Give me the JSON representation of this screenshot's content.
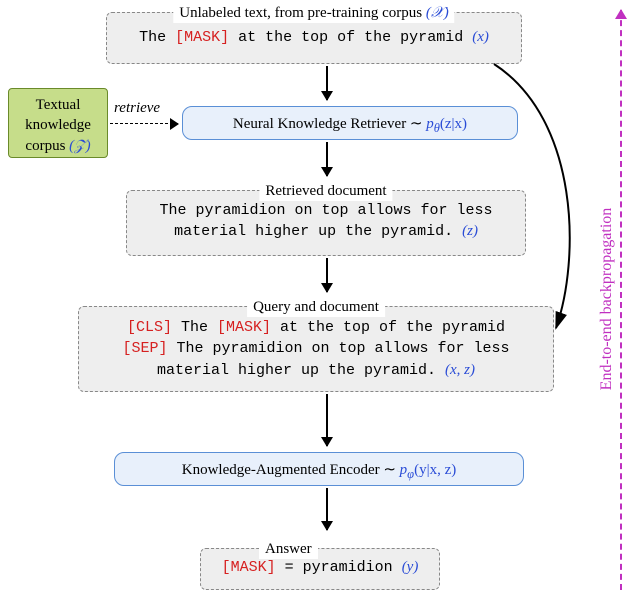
{
  "box1": {
    "title_a": "Unlabeled text, from pre-training corpus ",
    "title_b": "(𝒳)",
    "line1_a": "The ",
    "line1_mask": "[MASK]",
    "line1_b": " at the top of the pyramid ",
    "line1_var": "(x)"
  },
  "knowledge": {
    "l1": "Textual",
    "l2": "knowledge",
    "l3": "corpus ",
    "l3v": "(𝒵)"
  },
  "retrieve_label": "retrieve",
  "retriever": {
    "label": "Neural Knowledge Retriever ∼ ",
    "math": "p",
    "sub": "θ",
    "arg": "(z|x)"
  },
  "box2": {
    "title": "Retrieved document",
    "l1": "The pyramidion on top allows for less",
    "l2a": "material higher up the pyramid. ",
    "l2v": "(z)"
  },
  "box3": {
    "title": "Query and document",
    "l1_cls": "[CLS]",
    "l1_a": " The ",
    "l1_mask": "[MASK]",
    "l1_b": " at the top of the pyramid",
    "l2_sep": "[SEP]",
    "l2_a": " The pyramidion on top allows for less",
    "l3a": "material higher up the pyramid. ",
    "l3v": "(x, z)"
  },
  "encoder": {
    "label": "Knowledge-Augmented Encoder ∼ ",
    "math": "p",
    "sub": "φ",
    "arg": "(y|x, z)"
  },
  "answer": {
    "title": "Answer",
    "mask": "[MASK]",
    "eq": " = pyramidion ",
    "var": "(y)"
  },
  "side": "End-to-end backpropagation"
}
